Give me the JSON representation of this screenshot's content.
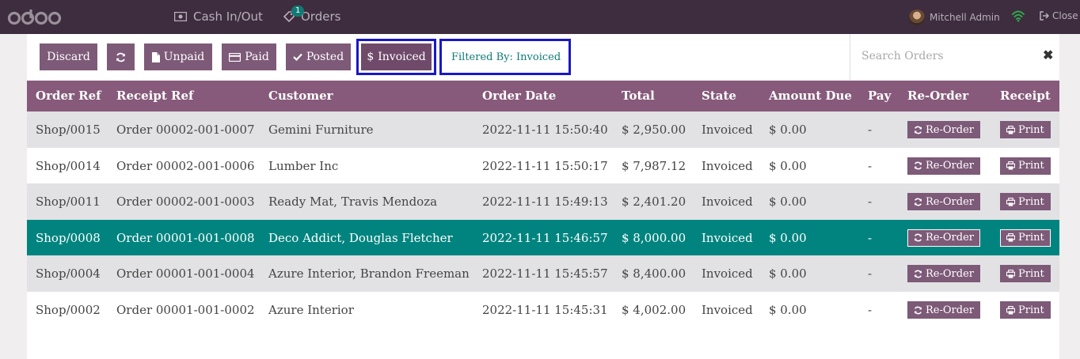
{
  "navbar": {
    "cash_label": "Cash In/Out",
    "orders_label": "Orders",
    "orders_badge": "1",
    "user_name": "Mitchell Admin",
    "close_label": "Close"
  },
  "controls": {
    "discard": "Discard",
    "unpaid": "Unpaid",
    "paid": "Paid",
    "posted": "Posted",
    "invoiced": "Invoiced",
    "filter_text": "Filtered By: Invoiced",
    "search_placeholder": "Search Orders"
  },
  "table": {
    "headers": [
      "Order Ref",
      "Receipt Ref",
      "Customer",
      "Order Date",
      "Total",
      "State",
      "Amount Due",
      "Pay",
      "Re-Order",
      "Receipt"
    ],
    "reorder_label": "Re-Order",
    "print_label": "Print",
    "rows": [
      {
        "order_ref": "Shop/0015",
        "receipt_ref": "Order 00002-001-0007",
        "customer": "Gemini Furniture",
        "date": "2022-11-11 15:50:40",
        "total": "$ 2,950.00",
        "state": "Invoiced",
        "due": "$ 0.00",
        "pay": "-"
      },
      {
        "order_ref": "Shop/0014",
        "receipt_ref": "Order 00002-001-0006",
        "customer": "Lumber Inc",
        "date": "2022-11-11 15:50:17",
        "total": "$ 7,987.12",
        "state": "Invoiced",
        "due": "$ 0.00",
        "pay": "-"
      },
      {
        "order_ref": "Shop/0011",
        "receipt_ref": "Order 00002-001-0003",
        "customer": "Ready Mat, Travis Mendoza",
        "date": "2022-11-11 15:49:13",
        "total": "$ 2,401.20",
        "state": "Invoiced",
        "due": "$ 0.00",
        "pay": "-"
      },
      {
        "order_ref": "Shop/0008",
        "receipt_ref": "Order 00001-001-0008",
        "customer": "Deco Addict, Douglas Fletcher",
        "date": "2022-11-11 15:46:57",
        "total": "$ 8,000.00",
        "state": "Invoiced",
        "due": "$ 0.00",
        "pay": "-"
      },
      {
        "order_ref": "Shop/0004",
        "receipt_ref": "Order 00001-001-0004",
        "customer": "Azure Interior, Brandon Freeman",
        "date": "2022-11-11 15:45:57",
        "total": "$ 8,400.00",
        "state": "Invoiced",
        "due": "$ 0.00",
        "pay": "-"
      },
      {
        "order_ref": "Shop/0002",
        "receipt_ref": "Order 00001-001-0002",
        "customer": "Azure Interior",
        "date": "2022-11-11 15:45:31",
        "total": "$ 4,002.00",
        "state": "Invoiced",
        "due": "$ 0.00",
        "pay": "-"
      }
    ]
  },
  "colors": {
    "navbar": "#3e2c3f",
    "header": "#875a7b",
    "button": "#7d5a78",
    "selected_row": "#01847f",
    "highlight_box": "#1a17c4"
  }
}
